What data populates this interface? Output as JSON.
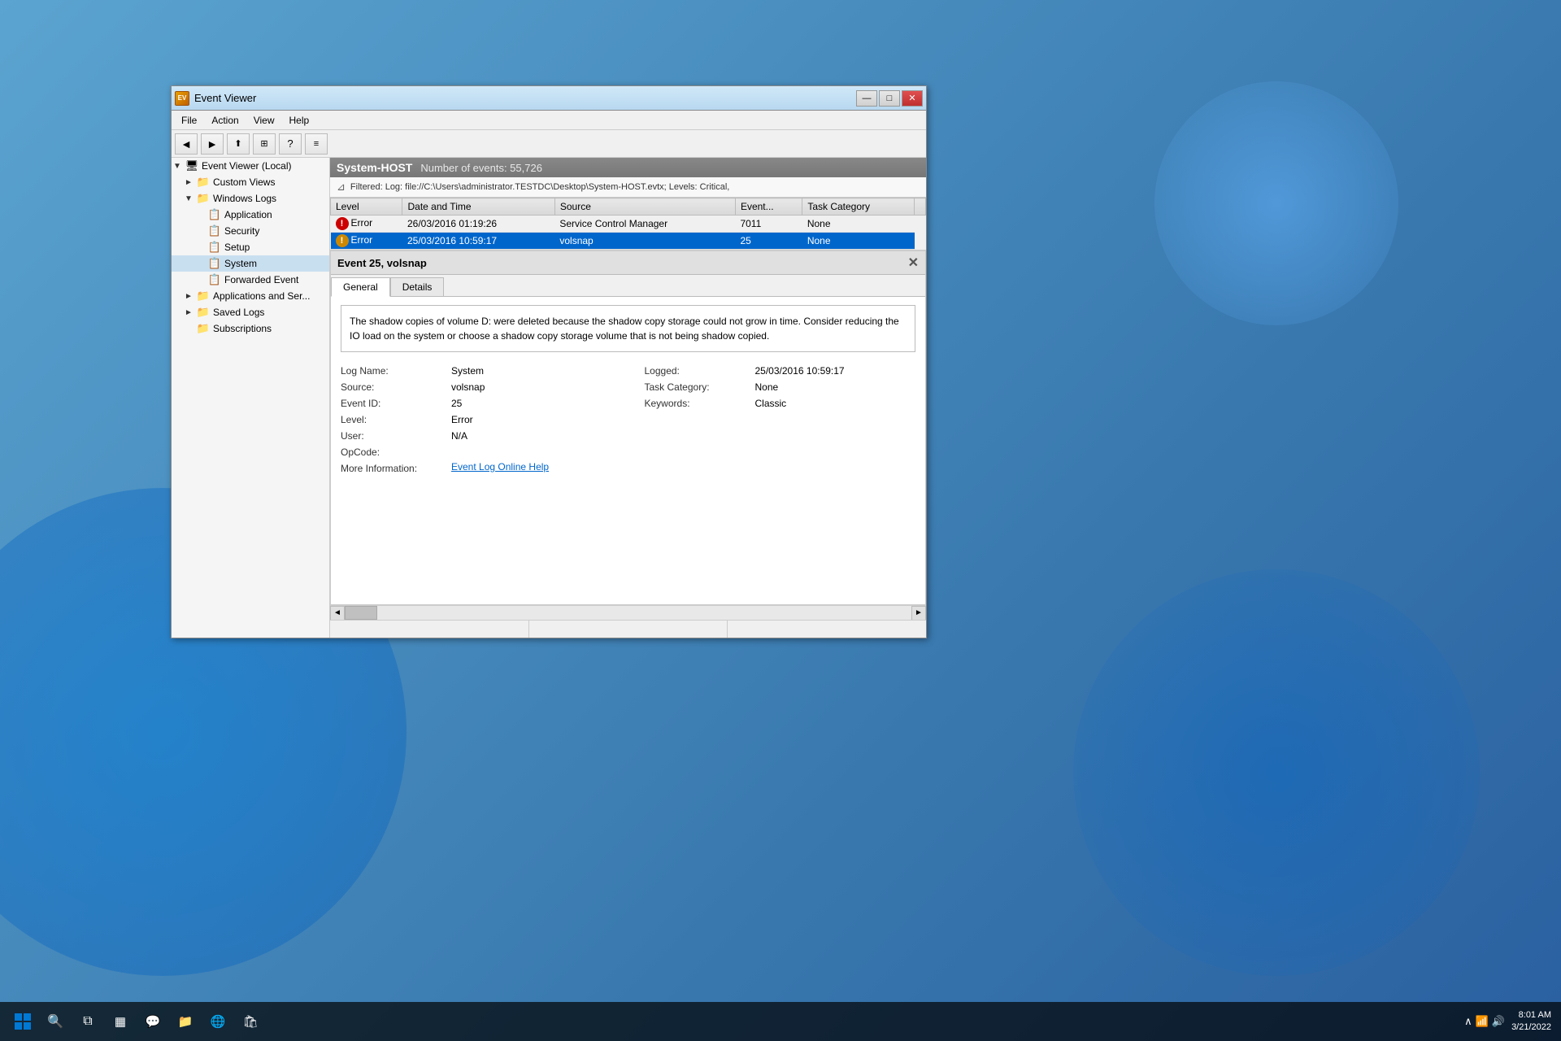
{
  "desktop": {
    "taskbar": {
      "time": "8:01 AM",
      "date": "3/21/2022",
      "start_label": "⊞",
      "search_label": "🔍",
      "task_view_label": "⧉",
      "widgets_label": "▦",
      "chat_label": "💬",
      "explorer_label": "📁",
      "edge_label": "🌐",
      "store_label": "🛍"
    }
  },
  "window": {
    "title": "Event Viewer",
    "icon": "EV",
    "buttons": {
      "minimize": "—",
      "maximize": "□",
      "close": "✕"
    }
  },
  "menu": {
    "items": [
      "File",
      "Action",
      "View",
      "Help"
    ]
  },
  "toolbar": {
    "back": "◄",
    "forward": "►",
    "up": "↑",
    "show_hide_console": "▦",
    "help": "?",
    "properties": "≡"
  },
  "sidebar": {
    "root": {
      "label": "Event Viewer (Local)",
      "children": [
        {
          "label": "Custom Views",
          "expanded": false,
          "icon": "folder"
        },
        {
          "label": "Windows Logs",
          "expanded": true,
          "icon": "folder",
          "children": [
            {
              "label": "Application",
              "icon": "log"
            },
            {
              "label": "Security",
              "icon": "log"
            },
            {
              "label": "Setup",
              "icon": "log"
            },
            {
              "label": "System",
              "icon": "log",
              "selected": true
            },
            {
              "label": "Forwarded Event",
              "icon": "log"
            }
          ]
        },
        {
          "label": "Applications and Ser...",
          "expanded": false,
          "icon": "folder"
        },
        {
          "label": "Saved Logs",
          "expanded": false,
          "icon": "folder"
        },
        {
          "label": "Subscriptions",
          "icon": "sub"
        }
      ]
    }
  },
  "panel": {
    "header": {
      "title": "System-HOST",
      "info": "Number of events: 55,726"
    },
    "filter": "Filtered: Log: file://C:\\Users\\administrator.TESTDC\\Desktop\\System-HOST.evtx; Levels: Critical,",
    "table": {
      "columns": [
        "Level",
        "Date and Time",
        "Source",
        "Event...",
        "Task Category"
      ],
      "rows": [
        {
          "level": "Error",
          "datetime": "26/03/2016 01:19:26",
          "source": "Service Control Manager",
          "event": "7011",
          "task_category": "None",
          "selected": false
        },
        {
          "level": "Error",
          "datetime": "25/03/2016 10:59:17",
          "source": "volsnap",
          "event": "25",
          "task_category": "None",
          "selected": true
        }
      ]
    }
  },
  "detail": {
    "title": "Event 25, volsnap",
    "tabs": [
      "General",
      "Details"
    ],
    "active_tab": "General",
    "message": "The shadow copies of volume D: were deleted because the shadow copy storage could not grow in time.  Consider reducing the IO load on the system or choose a shadow copy storage volume that is not being shadow copied.",
    "meta": {
      "log_name_label": "Log Name:",
      "log_name_value": "System",
      "source_label": "Source:",
      "source_value": "volsnap",
      "event_id_label": "Event ID:",
      "event_id_value": "25",
      "level_label": "Level:",
      "level_value": "Error",
      "user_label": "User:",
      "user_value": "N/A",
      "opcode_label": "OpCode:",
      "opcode_value": "",
      "more_info_label": "More Information:",
      "more_info_link": "Event Log Online Help",
      "logged_label": "Logged:",
      "logged_value": "25/03/2016 10:59:17",
      "task_category_label": "Task Category:",
      "task_category_value": "None",
      "keywords_label": "Keywords:",
      "keywords_value": "Classic"
    }
  },
  "status_bar": {
    "section1": "",
    "section2": "",
    "section3": ""
  }
}
